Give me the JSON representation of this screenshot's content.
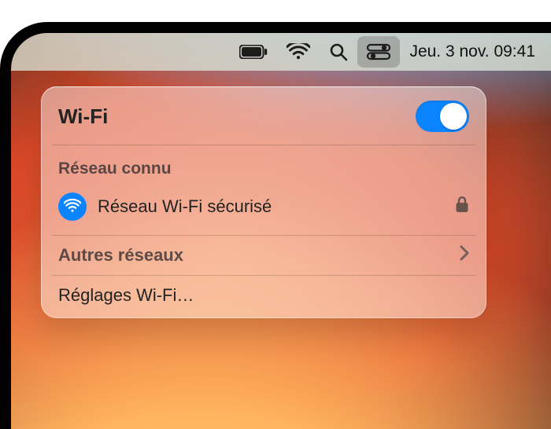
{
  "menubar": {
    "datetime": "Jeu. 3 nov. 09:41"
  },
  "panel": {
    "title": "Wi-Fi",
    "toggle_on": true,
    "known_section_label": "Réseau connu",
    "network": {
      "name": "Réseau Wi-Fi sécurisé",
      "secured": true
    },
    "other_networks_label": "Autres réseaux",
    "settings_label": "Réglages Wi-Fi…"
  },
  "colors": {
    "accent": "#0a84ff"
  }
}
